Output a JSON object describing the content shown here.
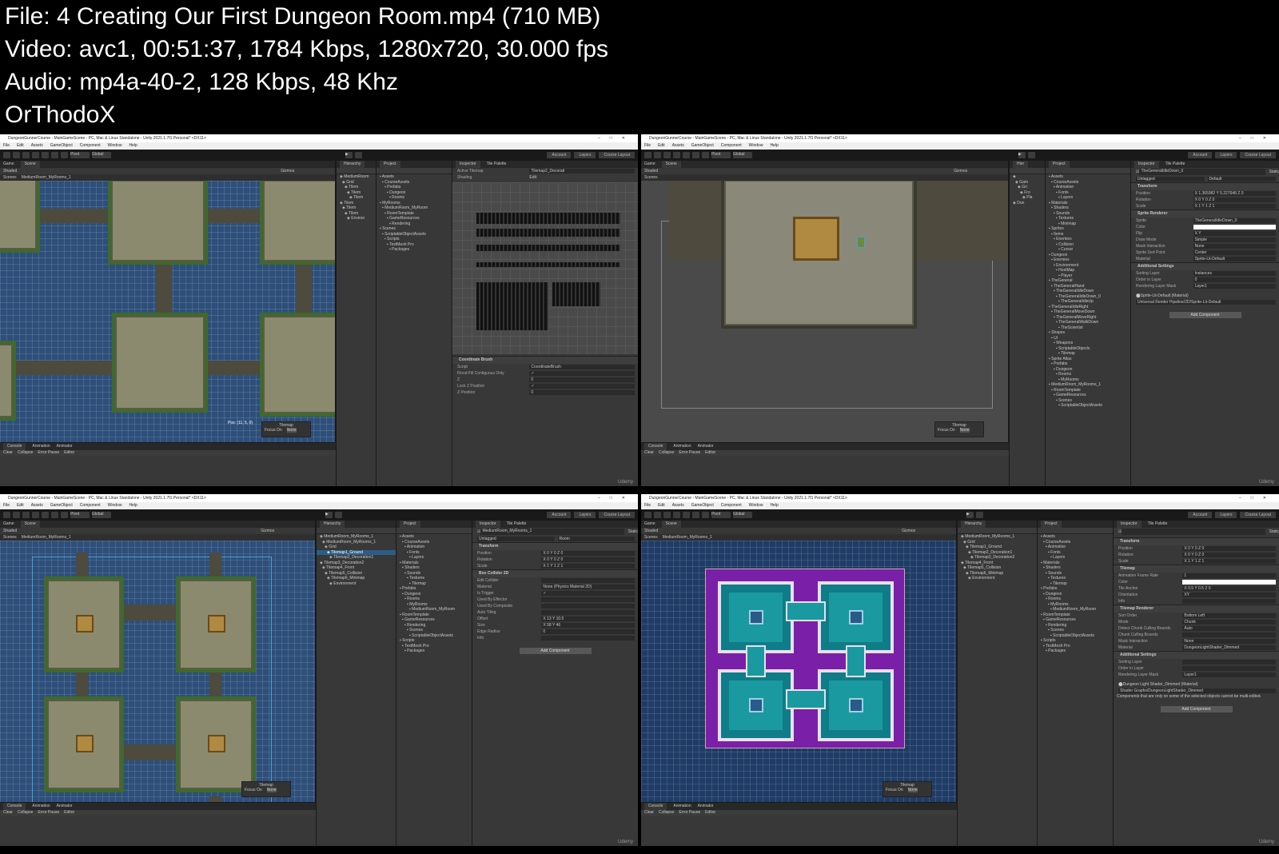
{
  "header": {
    "file": "File: 4  Creating Our First Dungeon Room.mp4 (710 MB)",
    "video": "Video: avc1, 00:51:37, 1784 Kbps, 1280x720, 30.000 fps",
    "audio": "Audio: mp4a-40-2, 128 Kbps, 48 Khz",
    "author": "OrThodoX"
  },
  "common": {
    "title": "DungeonGunnerCourse - MainGameScene - PC, Mac & Linux Standalone - Unity 2021.1.7f1 Personal* <DX11>",
    "menu": [
      "File",
      "Edit",
      "Assets",
      "GameObject",
      "Component",
      "Window",
      "Help"
    ],
    "pivot": "Pivot",
    "global": "Global",
    "account": "Account",
    "layers": "Layers",
    "layout": "Course Layout",
    "scene_tabs": [
      "Game",
      "Scene"
    ],
    "shading": "Shaded",
    "gizmos": "Gizmos",
    "breadcrumb_root": "Scenes",
    "console_tabs": [
      "Console",
      "Animation",
      "Animator"
    ],
    "console_btns": [
      "Clear",
      "Collapse",
      "Error Pause",
      "Editor"
    ],
    "tilemap_overlay": "Tilemap",
    "focus_on": "Focus On",
    "focus_value": "None",
    "watermark": "Udemy"
  },
  "frames": [
    {
      "scene": "rooms-blue",
      "breadcrumb": "MediumRoom_MyRooms_1",
      "pos": "Pos: (11, 5, 0)",
      "panes": [
        {
          "tabs": [
            "Hierarchy"
          ],
          "items": [
            "MediumRoom",
            "Grid",
            "Tilem",
            "Tilem",
            "Tilem",
            "Tilem",
            "Tilem",
            "Tilem",
            "Environ"
          ]
        },
        {
          "tabs": [
            "Project"
          ],
          "items": [
            "Assets",
            "CourseAssets",
            "Prefabs",
            "Dungeon",
            "Rooms",
            "MyRooms",
            "MediumRoom_MyRoom",
            "RoomTemplate",
            "GameResources",
            "Rendering",
            "Scenes",
            "ScriptableObjectAssets",
            "Scripts",
            "TextMesh Pro",
            "Packages"
          ]
        },
        {
          "tabs": [
            "Inspector",
            "Tile Palette"
          ],
          "palette": true,
          "active_tilemap": "Active Tilemap",
          "active_value": "Tilemap2_Decorati",
          "palette_name": "Shading",
          "edit": "Edit",
          "brush": "Coordinate Brush",
          "rows": [
            [
              "Script",
              "CoordinateBrush"
            ],
            [
              "Flood Fill Contiguous Only",
              "✓"
            ],
            [
              "Z",
              "0"
            ],
            [
              "Lock Z Position",
              "✓"
            ],
            [
              "Z Position",
              "0"
            ]
          ]
        }
      ]
    },
    {
      "scene": "room-gray",
      "breadcrumb": "",
      "panes": [
        {
          "tabs": [
            "Hier"
          ],
          "items": [
            "",
            "Gam",
            "Gri",
            "Fro",
            "Pla",
            "Dun"
          ]
        },
        {
          "tabs": [
            "Project"
          ],
          "items": [
            "Assets",
            "CourseAssets",
            "Animation",
            "Fonts",
            "Layers",
            "Materials",
            "Shaders",
            "Sounds",
            "Textures",
            "Minimap",
            "Sprites",
            "Items",
            "Enemies",
            "Collision",
            "Cursor",
            "Dungeon",
            "Enemies",
            "Environment",
            "HostMap",
            "Player",
            "TheGeneral",
            "TheGeneralHand",
            "TheGeneralIdleDown",
            "TheGeneralIdleDown_0",
            "TheGeneralIdleUp",
            "TheGeneralIdleRight",
            "TheGeneralMoveDown",
            "TheGeneralMoveRight",
            "TheGeneralWalkDown",
            "TheScientist",
            "Shapes",
            "UI",
            "Weapons",
            "ScriptableObjects",
            "Tilemap",
            "Sprite Atlas",
            "Prefabs",
            "Dungeon",
            "Rooms",
            "MyRooms",
            "MediumRoom_MyRooms_1",
            "RoomTemplate",
            "GameResources",
            "Scenes",
            "ScriptableObjectAssets"
          ]
        },
        {
          "tabs": [
            "Inspector",
            "Tile Palette"
          ],
          "object": "TheGeneralIdleDown_0",
          "static": "Static",
          "tag": "Untagged",
          "layer": "Default",
          "sections": [
            {
              "name": "Transform",
              "rows": [
                [
                  "Position",
                  "X 1.365982   Y 5.227648   Z 0"
                ],
                [
                  "Rotation",
                  "X 0   Y 0   Z 0"
                ],
                [
                  "Scale",
                  "X 1   Y 1   Z 1"
                ]
              ]
            },
            {
              "name": "Sprite Renderer",
              "rows": [
                [
                  "Sprite",
                  "TheGeneralIdleDown_0"
                ],
                [
                  "Color",
                  ""
                ],
                [
                  "Flip",
                  "X  Y"
                ],
                [
                  "Draw Mode",
                  "Simple"
                ],
                [
                  "Mask Interaction",
                  "None"
                ],
                [
                  "Sprite Sort Point",
                  "Center"
                ],
                [
                  "Material",
                  "Sprite-Lit-Default"
                ]
              ]
            },
            {
              "name": "Additional Settings",
              "rows": [
                [
                  "Sorting Layer",
                  "Instances"
                ],
                [
                  "Order in Layer",
                  "0"
                ],
                [
                  "Rendering Layer Mask",
                  "Layer1"
                ]
              ]
            }
          ],
          "material": "Sprite-Lit-Default (Material)",
          "shader": "Universal Render Pipeline/2D/Sprite-Lit-Default",
          "add": "Add Component"
        }
      ]
    },
    {
      "scene": "four-rooms",
      "breadcrumb": "MediumRoom_MyRooms_1",
      "panes": [
        {
          "tabs": [
            "Hierarchy"
          ],
          "items": [
            "MediumRoom_MyRooms_1",
            "MediumRoom_MyRooms_1",
            "Grid",
            "Tilemap1_Ground",
            "Tilemap2_Decoration1",
            "Tilemap3_Decoration2",
            "Tilemap4_Front",
            "Tilemap5_Collision",
            "Tilemap6_Minimap",
            "Environment"
          ],
          "selected": 3
        },
        {
          "tabs": [
            "Project"
          ],
          "items": [
            "Assets",
            "CourseAssets",
            "Animation",
            "Fonts",
            "Layers",
            "Materials",
            "Shaders",
            "Sounds",
            "Textures",
            "Tilemap",
            "Prefabs",
            "Dungeon",
            "Rooms",
            "MyRooms",
            "MediumRoom_MyRoom",
            "RoomTemplate",
            "GameResources",
            "Rendering",
            "Scenes",
            "ScriptableObjectAssets",
            "Scripts",
            "TextMesh Pro",
            "Packages"
          ]
        },
        {
          "tabs": [
            "Inspector",
            "Tile Palette"
          ],
          "object": "MediumRoom_MyRooms_1",
          "static": "Static",
          "tag": "Untagged",
          "layer": "Room",
          "sections": [
            {
              "name": "Transform",
              "rows": [
                [
                  "Position",
                  "X 0   Y 0   Z 0"
                ],
                [
                  "Rotation",
                  "X 0   Y 0   Z 0"
                ],
                [
                  "Scale",
                  "X 1   Y 1   Z 1"
                ]
              ]
            },
            {
              "name": "Box Collider 2D",
              "rows": [
                [
                  "Edit Collider",
                  ""
                ],
                [
                  "Material",
                  "None (Physics Material 2D)"
                ],
                [
                  "Is Trigger",
                  "✓"
                ],
                [
                  "Used By Effector",
                  ""
                ],
                [
                  "Used By Composite",
                  ""
                ],
                [
                  "Auto Tiling",
                  ""
                ],
                [
                  "Offset",
                  "X 13   Y 10.5"
                ],
                [
                  "Size",
                  "X 58   Y 46"
                ],
                [
                  "Edge Radius",
                  "0"
                ],
                [
                  "Info",
                  ""
                ]
              ]
            }
          ],
          "add": "Add Component"
        }
      ]
    },
    {
      "scene": "tilemap-purple",
      "breadcrumb": "MediumRoom_MyRooms_1",
      "panes": [
        {
          "tabs": [
            "Hierarchy"
          ],
          "items": [
            "MediumRoom_MyRooms_1",
            "Grid",
            "Tilemap1_Ground",
            "Tilemap2_Decoration1",
            "Tilemap3_Decoration2",
            "Tilemap4_Front",
            "Tilemap5_Collision",
            "Tilemap6_Minimap",
            "Environment"
          ]
        },
        {
          "tabs": [
            "Project"
          ],
          "items": [
            "Assets",
            "CourseAssets",
            "Animation",
            "Fonts",
            "Layers",
            "Materials",
            "Shaders",
            "Sounds",
            "Textures",
            "Tilemap",
            "Prefabs",
            "Dungeon",
            "Rooms",
            "MyRooms",
            "MediumRoom_MyRoom",
            "RoomTemplate",
            "GameResources",
            "Rendering",
            "Scenes",
            "ScriptableObjectAssets",
            "Scripts",
            "TextMesh Pro",
            "Packages"
          ]
        },
        {
          "tabs": [
            "Inspector",
            "Tile Palette"
          ],
          "object": "",
          "static": "Static",
          "tag": "",
          "layer": "",
          "sections": [
            {
              "name": "Transform",
              "rows": [
                [
                  "Position",
                  "X 0   Y 0   Z 0"
                ],
                [
                  "Rotation",
                  "X 0   Y 0   Z 0"
                ],
                [
                  "Scale",
                  "X 1   Y 1   Z 1"
                ]
              ]
            },
            {
              "name": "Tilemap",
              "rows": [
                [
                  "Animation Frame Rate",
                  "1"
                ],
                [
                  "Color",
                  ""
                ],
                [
                  "Tile Anchor",
                  "X 0.5   Y 0.5   Z 0"
                ],
                [
                  "Orientation",
                  "XY"
                ],
                [
                  "Info",
                  ""
                ]
              ]
            },
            {
              "name": "Tilemap Renderer",
              "rows": [
                [
                  "Sort Order",
                  "Bottom Left"
                ],
                [
                  "Mode",
                  "Chunk"
                ],
                [
                  "Detect Chunk Culling Bounds",
                  "Auto"
                ],
                [
                  "Chunk Culling Bounds",
                  ""
                ],
                [
                  "Mask Interaction",
                  "None"
                ],
                [
                  "Material",
                  "DungeonLightShader_Dimmed"
                ]
              ]
            },
            {
              "name": "Additional Settings",
              "rows": [
                [
                  "Sorting Layer",
                  ""
                ],
                [
                  "Order in Layer",
                  ""
                ],
                [
                  "Rendering Layer Mask",
                  "Layer1"
                ]
              ]
            }
          ],
          "material": "Dungeon Light Shader_Dimmed (Material)",
          "shader": "Shader Graphs/DungeonLightShader_Dimmed",
          "note": "Components that are only on some of the selected objects cannot be multi-edited.",
          "add": "Add Component"
        }
      ]
    }
  ]
}
